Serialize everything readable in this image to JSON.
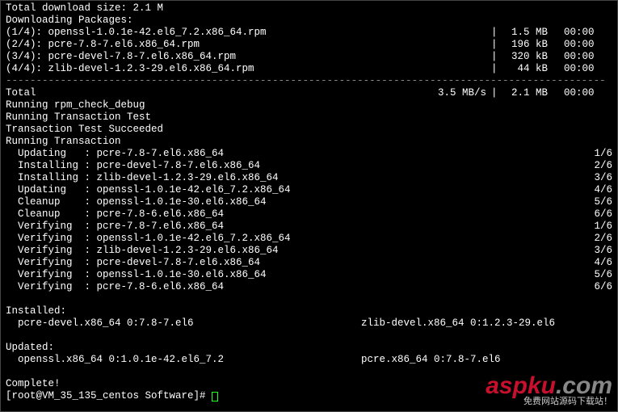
{
  "header": {
    "total_size": "Total download size: 2.1 M",
    "downloading": "Downloading Packages:"
  },
  "downloads": [
    {
      "idx": "(1/4)",
      "name": "openssl-1.0.1e-42.el6_7.2.x86_64.rpm",
      "size": "1.5 MB",
      "time": "00:00"
    },
    {
      "idx": "(2/4)",
      "name": "pcre-7.8-7.el6.x86_64.rpm",
      "size": "196 kB",
      "time": "00:00"
    },
    {
      "idx": "(3/4)",
      "name": "pcre-devel-7.8-7.el6.x86_64.rpm",
      "size": "320 kB",
      "time": "00:00"
    },
    {
      "idx": "(4/4)",
      "name": "zlib-devel-1.2.3-29.el6.x86_64.rpm",
      "size": " 44 kB",
      "time": "00:00"
    }
  ],
  "separator": "---------------------------------------------------------------------------------------------------",
  "total_row": {
    "label": "Total",
    "rate": "3.5 MB/s",
    "size": "2.1 MB",
    "time": "00:00"
  },
  "progress_msgs": [
    "Running rpm_check_debug",
    "Running Transaction Test",
    "Transaction Test Succeeded",
    "Running Transaction"
  ],
  "transactions": [
    {
      "action": "Updating",
      "pkg": "pcre-7.8-7.el6.x86_64",
      "count": "1/6"
    },
    {
      "action": "Installing",
      "pkg": "pcre-devel-7.8-7.el6.x86_64",
      "count": "2/6"
    },
    {
      "action": "Installing",
      "pkg": "zlib-devel-1.2.3-29.el6.x86_64",
      "count": "3/6"
    },
    {
      "action": "Updating",
      "pkg": "openssl-1.0.1e-42.el6_7.2.x86_64",
      "count": "4/6"
    },
    {
      "action": "Cleanup",
      "pkg": "openssl-1.0.1e-30.el6.x86_64",
      "count": "5/6"
    },
    {
      "action": "Cleanup",
      "pkg": "pcre-7.8-6.el6.x86_64",
      "count": "6/6"
    },
    {
      "action": "Verifying",
      "pkg": "pcre-7.8-7.el6.x86_64",
      "count": "1/6"
    },
    {
      "action": "Verifying",
      "pkg": "openssl-1.0.1e-42.el6_7.2.x86_64",
      "count": "2/6"
    },
    {
      "action": "Verifying",
      "pkg": "zlib-devel-1.2.3-29.el6.x86_64",
      "count": "3/6"
    },
    {
      "action": "Verifying",
      "pkg": "pcre-devel-7.8-7.el6.x86_64",
      "count": "4/6"
    },
    {
      "action": "Verifying",
      "pkg": "openssl-1.0.1e-30.el6.x86_64",
      "count": "5/6"
    },
    {
      "action": "Verifying",
      "pkg": "pcre-7.8-6.el6.x86_64",
      "count": "6/6"
    }
  ],
  "installed": {
    "heading": "Installed:",
    "items": [
      "  pcre-devel.x86_64 0:7.8-7.el6",
      "zlib-devel.x86_64 0:1.2.3-29.el6"
    ]
  },
  "updated": {
    "heading": "Updated:",
    "items": [
      "  openssl.x86_64 0:1.0.1e-42.el6_7.2",
      "pcre.x86_64 0:7.8-7.el6"
    ]
  },
  "complete": "Complete!",
  "prompt": "[root@VM_35_135_centos Software]# ",
  "watermark": {
    "brand_r": "aspku",
    "brand_g": ".com",
    "sub": "免费网站源码下载站！"
  }
}
